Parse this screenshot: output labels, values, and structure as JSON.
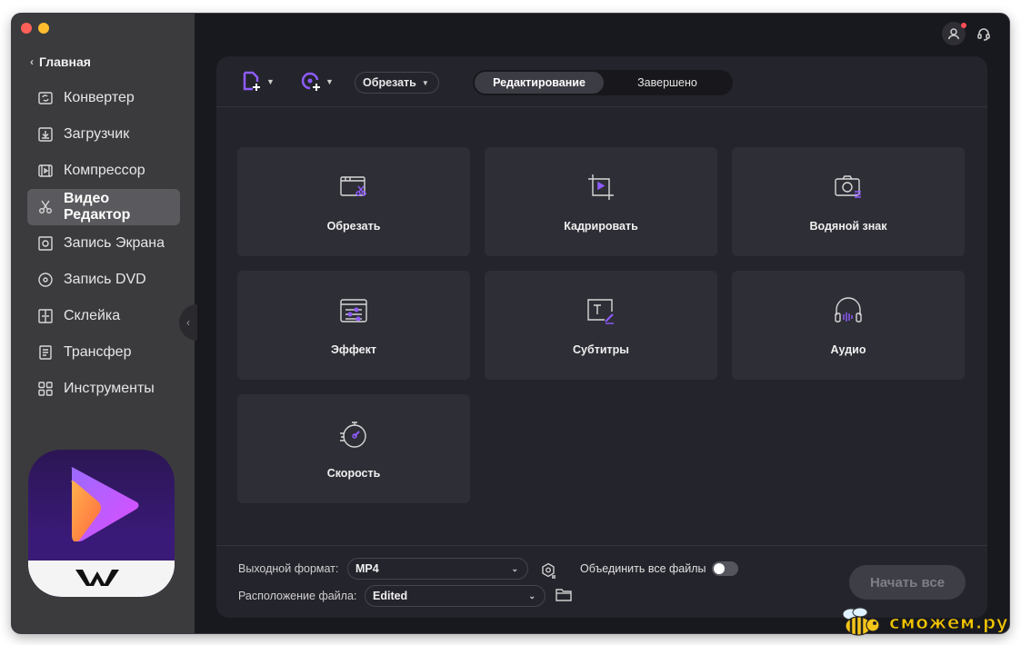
{
  "sidebar": {
    "back_label": "Главная",
    "items": [
      {
        "label": "Конвертер",
        "icon": "converter-icon"
      },
      {
        "label": "Загрузчик",
        "icon": "download-icon"
      },
      {
        "label": "Компрессор",
        "icon": "compress-icon"
      },
      {
        "label": "Видео Редактор",
        "icon": "scissors-icon",
        "active": true
      },
      {
        "label": "Запись Экрана",
        "icon": "screen-record-icon"
      },
      {
        "label": "Запись DVD",
        "icon": "dvd-icon"
      },
      {
        "label": "Склейка",
        "icon": "merge-icon"
      },
      {
        "label": "Трансфер",
        "icon": "transfer-icon"
      },
      {
        "label": "Инструменты",
        "icon": "grid-icon"
      }
    ]
  },
  "toolbar": {
    "add_file_icon": "add-file-icon",
    "add_media_icon": "add-media-icon",
    "dropdown_label": "Обрезать",
    "tabs": [
      {
        "label": "Редактирование",
        "active": true
      },
      {
        "label": "Завершено",
        "active": false
      }
    ]
  },
  "cards": [
    {
      "label": "Обрезать",
      "icon": "trim-icon"
    },
    {
      "label": "Кадрировать",
      "icon": "crop-icon"
    },
    {
      "label": "Водяной знак",
      "icon": "watermark-icon"
    },
    {
      "label": "Эффект",
      "icon": "effect-icon"
    },
    {
      "label": "Субтитры",
      "icon": "subtitles-icon"
    },
    {
      "label": "Аудио",
      "icon": "audio-icon"
    },
    {
      "label": "Скорость",
      "icon": "speed-icon"
    }
  ],
  "footer": {
    "output_format_label": "Выходной формат:",
    "output_format_value": "MP4",
    "merge_label": "Объединить все файлы",
    "merge_enabled": false,
    "location_label": "Расположение файла:",
    "location_value": "Edited",
    "start_button": "Начать все"
  },
  "watermark": {
    "text": "сможем.ру"
  },
  "colors": {
    "accent": "#8f5cff",
    "sidebar_bg": "#3b3b3e",
    "panel_bg": "#24242c",
    "card_bg": "#2e2e36"
  }
}
